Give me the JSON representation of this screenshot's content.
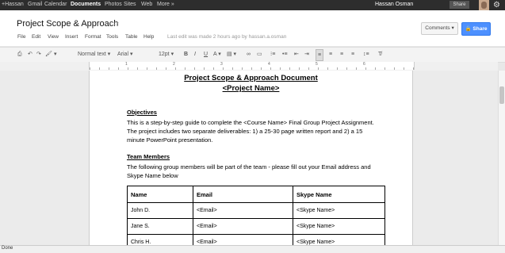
{
  "gbar": {
    "nav": [
      "+Hassan",
      "Gmail",
      "Calendar",
      "Documents",
      "Photos",
      "Sites",
      "Web",
      "More »"
    ],
    "user": "Hassan Osman",
    "share": "Share"
  },
  "header": {
    "title": "Project Scope & Approach",
    "menus": [
      "File",
      "Edit",
      "View",
      "Insert",
      "Format",
      "Tools",
      "Table",
      "Help"
    ],
    "last_edit": "Last edit was made 2 hours ago by hassan.a.osman",
    "comments_label": "Comments ▾",
    "share_label": "🔒 Share"
  },
  "toolbar": {
    "style": "Normal text",
    "font": "Arial",
    "size": "12pt"
  },
  "ruler": [
    "1",
    "2",
    "3",
    "4",
    "5",
    "6"
  ],
  "doc": {
    "title": "Project Scope & Approach Document",
    "subtitle": "<Project Name>",
    "objectives_heading": "Objectives",
    "objectives_text": "This is a step-by-step guide to complete the <Course Name> Final Group Project Assignment. The project includes two separate deliverables: 1) a 25-30 page written report and 2) a 15 minute PowerPoint presentation.",
    "team_heading": "Team Members",
    "team_text": "The following group members will be part of the team - please fill out your Email address and Skype Name below",
    "table": {
      "headers": [
        "Name",
        "Email",
        "Skype Name"
      ],
      "rows": [
        [
          "John D.",
          "<Email>",
          "<Skype Name>"
        ],
        [
          "Jane S.",
          "<Email>",
          "<Skype Name>"
        ],
        [
          "Chris H.",
          "<Email>",
          "<Skype Name>"
        ]
      ]
    }
  },
  "status": "Done"
}
